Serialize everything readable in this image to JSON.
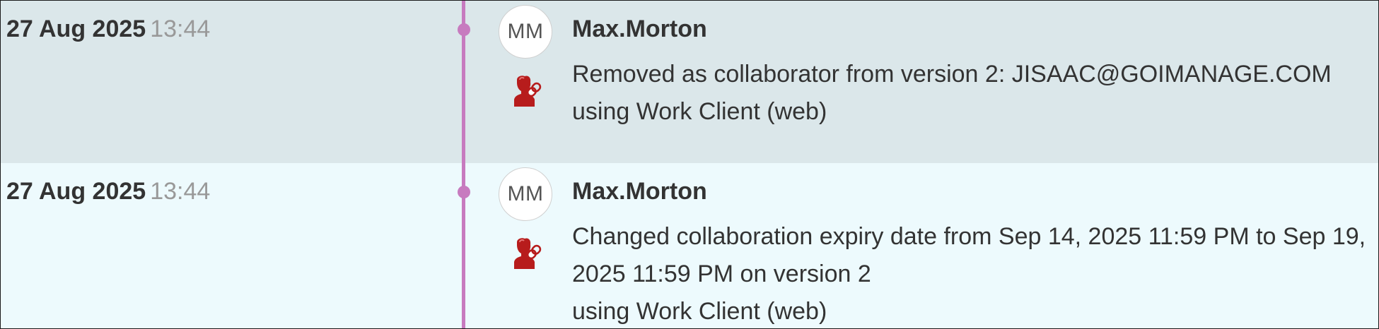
{
  "entries": [
    {
      "date": "27 Aug 2025",
      "time": "13:44",
      "avatar_initials": "MM",
      "user": "Max.Morton",
      "action_icon": "collaborator-link-icon",
      "description": "Removed as collaborator from version 2: JISAAC@GOIMANAGE.COM",
      "via": "using Work Client (web)"
    },
    {
      "date": "27 Aug 2025",
      "time": "13:44",
      "avatar_initials": "MM",
      "user": "Max.Morton",
      "action_icon": "collaborator-link-icon",
      "description": "Changed collaboration expiry date from Sep 14, 2025 11:59 PM to Sep 19, 2025 11:59 PM on version 2",
      "via": "using Work Client (web)"
    }
  ],
  "colors": {
    "timeline": "#c77bbf",
    "row_selected_bg": "#dbe7ea",
    "row_bg": "#edfafd",
    "icon_red": "#b71c1c"
  }
}
